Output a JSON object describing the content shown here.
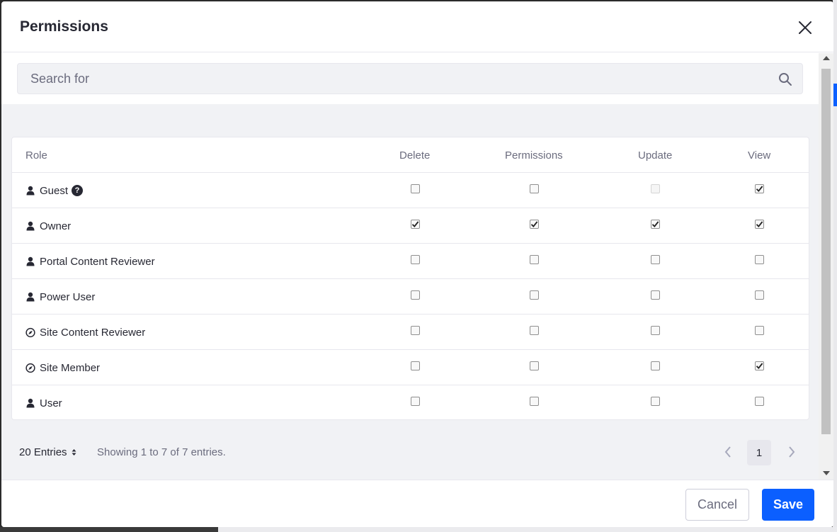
{
  "modal": {
    "title": "Permissions"
  },
  "search": {
    "placeholder": "Search for",
    "value": ""
  },
  "table": {
    "headers": {
      "role": "Role",
      "delete": "Delete",
      "permissions": "Permissions",
      "update": "Update",
      "view": "View"
    },
    "rows": [
      {
        "role": "Guest",
        "icon": "user-icon",
        "help": "?",
        "delete": false,
        "permissions": false,
        "update": null,
        "view": true
      },
      {
        "role": "Owner",
        "icon": "user-icon",
        "delete": true,
        "permissions": true,
        "update": true,
        "view": true
      },
      {
        "role": "Portal Content Reviewer",
        "icon": "user-icon",
        "delete": false,
        "permissions": false,
        "update": false,
        "view": false
      },
      {
        "role": "Power User",
        "icon": "user-icon",
        "delete": false,
        "permissions": false,
        "update": false,
        "view": false
      },
      {
        "role": "Site Content Reviewer",
        "icon": "compass-icon",
        "delete": false,
        "permissions": false,
        "update": false,
        "view": false
      },
      {
        "role": "Site Member",
        "icon": "compass-icon",
        "delete": false,
        "permissions": false,
        "update": false,
        "view": true
      },
      {
        "role": "User",
        "icon": "user-icon",
        "delete": false,
        "permissions": false,
        "update": false,
        "view": false
      }
    ]
  },
  "pagination": {
    "entries_label": "20 Entries",
    "showing": "Showing 1 to 7 of 7 entries.",
    "current_page": "1"
  },
  "footer": {
    "cancel_label": "Cancel",
    "save_label": "Save"
  },
  "colors": {
    "primary": "#0b5fff",
    "text": "#272833",
    "secondary_text": "#6b6c7e",
    "body_bg": "#f1f2f5"
  }
}
